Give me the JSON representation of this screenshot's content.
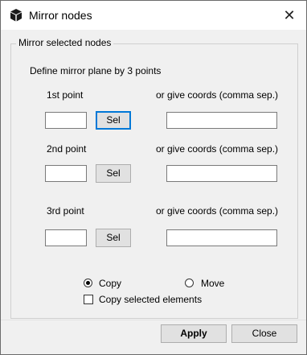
{
  "window": {
    "title": "Mirror nodes",
    "icon": "cube-icon",
    "close_glyph": "✕"
  },
  "group": {
    "legend": "Mirror selected nodes",
    "instruction": "Define mirror plane by 3 points",
    "points": [
      {
        "label": "1st point",
        "coords_label": "or give coords (comma sep.)",
        "node_value": "",
        "coords_value": "",
        "sel_label": "Sel"
      },
      {
        "label": "2nd point",
        "coords_label": "or give coords (comma sep.)",
        "node_value": "",
        "coords_value": "",
        "sel_label": "Sel"
      },
      {
        "label": "3rd point",
        "coords_label": "or give coords (comma sep.)",
        "node_value": "",
        "coords_value": "",
        "sel_label": "Sel"
      }
    ],
    "mode": {
      "copy_label": "Copy",
      "move_label": "Move",
      "selected": "Copy"
    },
    "copy_elements": {
      "label": "Copy selected elements",
      "checked": false
    }
  },
  "buttons": {
    "apply": "Apply",
    "close": "Close"
  }
}
